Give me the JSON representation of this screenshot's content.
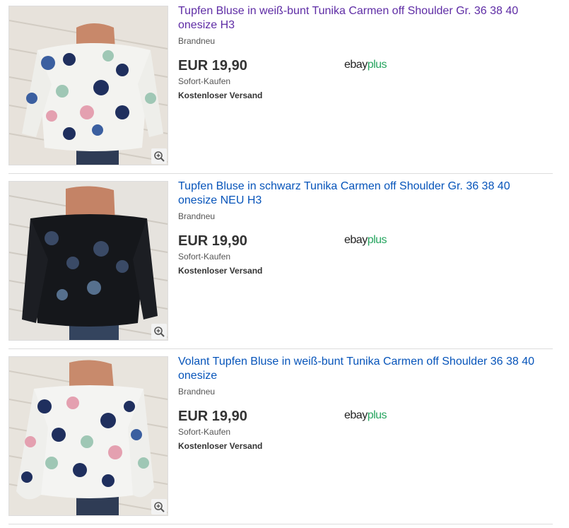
{
  "listings": [
    {
      "title": "Tupfen Bluse in weiß-bunt Tunika Carmen off Shoulder Gr. 36 38 40 onesize H3",
      "visited": true,
      "condition": "Brandneu",
      "price": "EUR 19,90",
      "buying_format": "Sofort-Kaufen",
      "shipping": "Kostenloser Versand",
      "badge_ebay": "ebay",
      "badge_plus": "plus",
      "image_variant": "white-dots",
      "zoom_icon": "magnifier-plus-icon"
    },
    {
      "title": "Tupfen Bluse in schwarz Tunika Carmen off Shoulder Gr. 36 38 40 onesize NEU H3",
      "visited": false,
      "condition": "Brandneu",
      "price": "EUR 19,90",
      "buying_format": "Sofort-Kaufen",
      "shipping": "Kostenloser Versand",
      "badge_ebay": "ebay",
      "badge_plus": "plus",
      "image_variant": "black-dots",
      "zoom_icon": "magnifier-plus-icon"
    },
    {
      "title": "Volant Tupfen Bluse in weiß-bunt Tunika Carmen off Shoulder 36 38 40 onesize",
      "visited": false,
      "condition": "Brandneu",
      "price": "EUR 19,90",
      "buying_format": "Sofort-Kaufen",
      "shipping": "Kostenloser Versand",
      "badge_ebay": "ebay",
      "badge_plus": "plus",
      "image_variant": "white-dots-volant",
      "zoom_icon": "magnifier-plus-icon"
    }
  ],
  "colors": {
    "link": "#0654ba",
    "visited_link": "#5e2ca5",
    "plus_green": "#26a55f"
  }
}
